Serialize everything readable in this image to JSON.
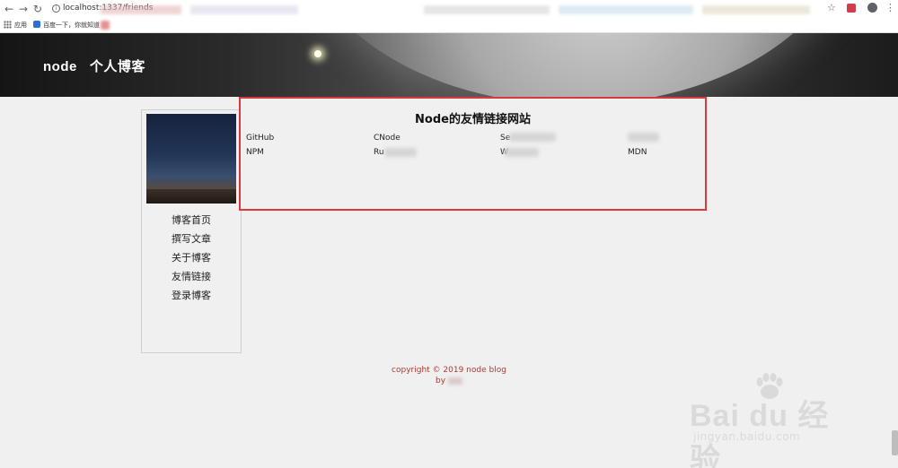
{
  "browser": {
    "url": "localhost:1337/friends",
    "bookmarks": [
      {
        "label": "应用"
      },
      {
        "label": "百度一下，你就知道"
      }
    ]
  },
  "site": {
    "title": "node   个人博客"
  },
  "sidebar": {
    "items": [
      {
        "label": "博客首页"
      },
      {
        "label": "撰写文章"
      },
      {
        "label": "关于博客"
      },
      {
        "label": "友情链接"
      },
      {
        "label": "登录博客"
      }
    ]
  },
  "friends": {
    "title": "Node的友情链接网站",
    "links": [
      {
        "label": "GitHub"
      },
      {
        "label": "CNode"
      },
      {
        "label": "Se"
      },
      {
        "label": ""
      },
      {
        "label": "NPM"
      },
      {
        "label": "Ru"
      },
      {
        "label": "W"
      },
      {
        "label": "MDN"
      }
    ]
  },
  "footer": {
    "copyright": "copyright © 2019 node blog",
    "by": "by"
  },
  "watermark": {
    "main": "Bai du 经验",
    "sub": "jingyan.baidu.com"
  },
  "colors": {
    "panel_border": "#d9393c",
    "footer_text": "#b03a2e",
    "page_bg": "#f0f0f0"
  }
}
